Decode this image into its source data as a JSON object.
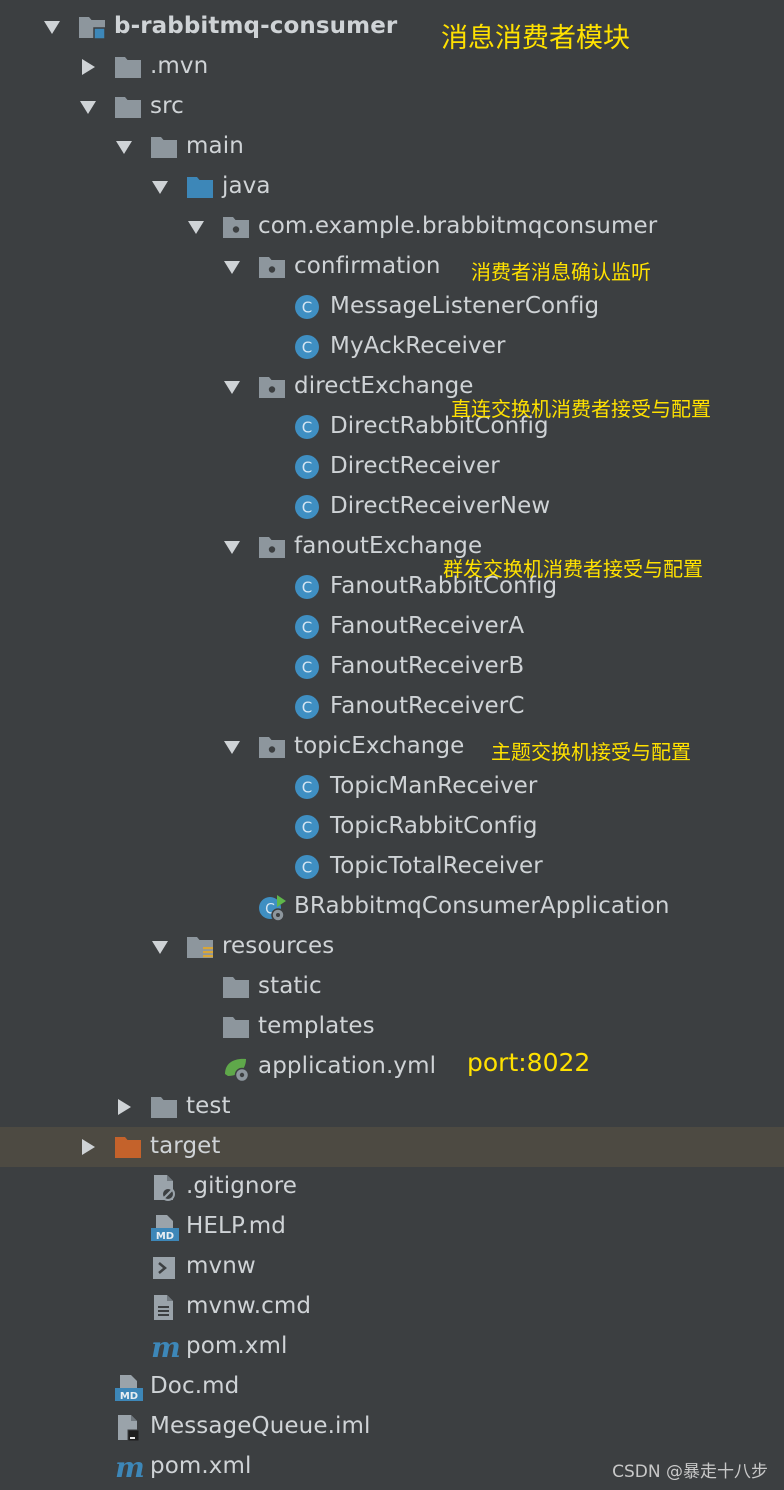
{
  "tree": [
    {
      "label": "b-rabbitmq-consumer",
      "icon": "module-icon",
      "arrow": "down",
      "depth": 0,
      "bold": true
    },
    {
      "label": ".mvn",
      "icon": "folder-icon",
      "arrow": "right",
      "depth": 1
    },
    {
      "label": "src",
      "icon": "folder-icon",
      "arrow": "down",
      "depth": 1
    },
    {
      "label": "main",
      "icon": "folder-icon",
      "arrow": "down",
      "depth": 2
    },
    {
      "label": "java",
      "icon": "source-folder-icon",
      "arrow": "down",
      "depth": 3
    },
    {
      "label": "com.example.brabbitmqconsumer",
      "icon": "package-icon",
      "arrow": "down",
      "depth": 4
    },
    {
      "label": "confirmation",
      "icon": "package-icon",
      "arrow": "down",
      "depth": 5
    },
    {
      "label": "MessageListenerConfig",
      "icon": "java-class-icon",
      "arrow": "none",
      "depth": 6
    },
    {
      "label": "MyAckReceiver",
      "icon": "java-class-icon",
      "arrow": "none",
      "depth": 6
    },
    {
      "label": "directExchange",
      "icon": "package-icon",
      "arrow": "down",
      "depth": 5
    },
    {
      "label": "DirectRabbitConfig",
      "icon": "java-class-icon",
      "arrow": "none",
      "depth": 6
    },
    {
      "label": "DirectReceiver",
      "icon": "java-class-icon",
      "arrow": "none",
      "depth": 6
    },
    {
      "label": "DirectReceiverNew",
      "icon": "java-class-icon",
      "arrow": "none",
      "depth": 6
    },
    {
      "label": "fanoutExchange",
      "icon": "package-icon",
      "arrow": "down",
      "depth": 5
    },
    {
      "label": "FanoutRabbitConfig",
      "icon": "java-class-icon",
      "arrow": "none",
      "depth": 6
    },
    {
      "label": "FanoutReceiverA",
      "icon": "java-class-icon",
      "arrow": "none",
      "depth": 6
    },
    {
      "label": "FanoutReceiverB",
      "icon": "java-class-icon",
      "arrow": "none",
      "depth": 6
    },
    {
      "label": "FanoutReceiverC",
      "icon": "java-class-icon",
      "arrow": "none",
      "depth": 6
    },
    {
      "label": "topicExchange",
      "icon": "package-icon",
      "arrow": "down",
      "depth": 5
    },
    {
      "label": "TopicManReceiver",
      "icon": "java-class-icon",
      "arrow": "none",
      "depth": 6
    },
    {
      "label": "TopicRabbitConfig",
      "icon": "java-class-icon",
      "arrow": "none",
      "depth": 6
    },
    {
      "label": "TopicTotalReceiver",
      "icon": "java-class-icon",
      "arrow": "none",
      "depth": 6
    },
    {
      "label": "BRabbitmqConsumerApplication",
      "icon": "spring-boot-app-icon",
      "arrow": "none",
      "depth": 5
    },
    {
      "label": "resources",
      "icon": "resources-folder-icon",
      "arrow": "down",
      "depth": 3
    },
    {
      "label": "static",
      "icon": "folder-icon",
      "arrow": "none",
      "depth": 4
    },
    {
      "label": "templates",
      "icon": "folder-icon",
      "arrow": "none",
      "depth": 4
    },
    {
      "label": "application.yml",
      "icon": "spring-config-icon",
      "arrow": "none",
      "depth": 4
    },
    {
      "label": "test",
      "icon": "folder-icon",
      "arrow": "right",
      "depth": 2
    },
    {
      "label": "target",
      "icon": "excluded-folder-icon",
      "arrow": "right",
      "depth": 1,
      "selected": true
    },
    {
      "label": ".gitignore",
      "icon": "ignore-file-icon",
      "arrow": "none",
      "depth": 2
    },
    {
      "label": "HELP.md",
      "icon": "markdown-file-icon",
      "arrow": "none",
      "depth": 2
    },
    {
      "label": "mvnw",
      "icon": "shell-script-icon",
      "arrow": "none",
      "depth": 2
    },
    {
      "label": "mvnw.cmd",
      "icon": "text-file-icon",
      "arrow": "none",
      "depth": 2
    },
    {
      "label": "pom.xml",
      "icon": "maven-icon",
      "arrow": "none",
      "depth": 2
    },
    {
      "label": "Doc.md",
      "icon": "markdown-file-icon",
      "arrow": "none",
      "depth": 1
    },
    {
      "label": "MessageQueue.iml",
      "icon": "iml-file-icon",
      "arrow": "none",
      "depth": 1
    },
    {
      "label": "pom.xml",
      "icon": "maven-icon",
      "arrow": "none",
      "depth": 1
    }
  ],
  "annotations": {
    "module": "消息消费者模块",
    "confirmation": "消费者消息确认监听",
    "direct": "直连交换机消费者接受与配置",
    "fanout": "群发交换机消费者接受与配置",
    "topic": "主题交换机接受与配置",
    "port": "port:8022"
  },
  "watermark": "CSDN @暴走十八步",
  "colors": {
    "background": "#3c3f41",
    "selected_row": "#4d4a42",
    "text": "#cfd3d6",
    "annotation": "#ffe100",
    "folder": "#8d969d",
    "source_folder": "#3d87b8",
    "excluded_folder": "#c4622b",
    "java_class": "#3f8fc2",
    "maven": "#3d87b8"
  }
}
